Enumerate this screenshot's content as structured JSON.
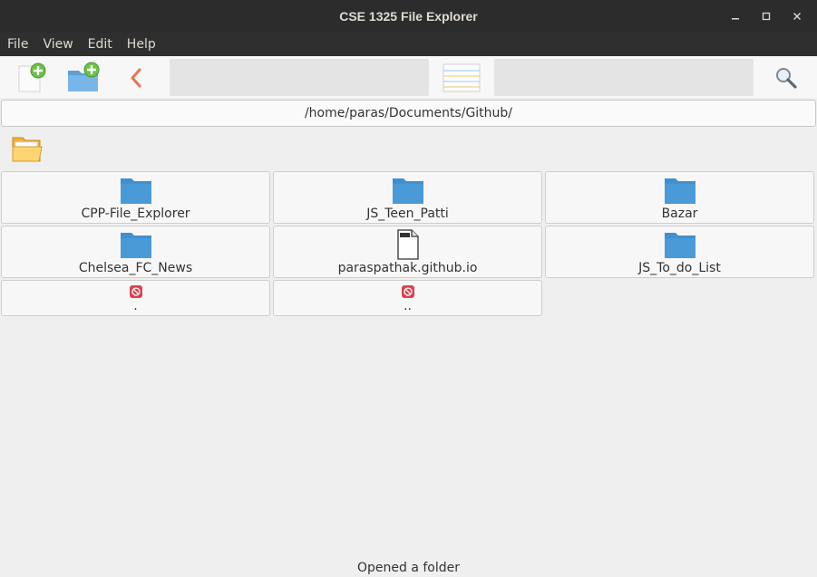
{
  "window": {
    "title": "CSE 1325 File Explorer",
    "controls": {
      "minimize": "–",
      "maximize": "☐",
      "close": "✕"
    }
  },
  "menubar": {
    "items": [
      "File",
      "View",
      "Edit",
      "Help"
    ]
  },
  "toolbar": {
    "new_file_icon": "new-file-icon",
    "new_folder_icon": "new-folder-icon",
    "back_icon": "back-icon",
    "view_icon": "view-list-icon",
    "search_icon": "search-icon"
  },
  "path": {
    "current": "/home/paras/Documents/Github/"
  },
  "entries": [
    {
      "name": "CPP-File_Explorer",
      "type": "folder"
    },
    {
      "name": "JS_Teen_Patti",
      "type": "folder"
    },
    {
      "name": "Bazar",
      "type": "folder"
    },
    {
      "name": "Chelsea_FC_News",
      "type": "folder"
    },
    {
      "name": "paraspathak.github.io",
      "type": "file"
    },
    {
      "name": "JS_To_do_List",
      "type": "folder"
    },
    {
      "name": ".",
      "type": "special"
    },
    {
      "name": "..",
      "type": "special"
    }
  ],
  "status": {
    "message": "Opened a folder"
  },
  "colors": {
    "titlebar": "#2c2c2c",
    "folder_blue": "#4a9ad8",
    "accent_orange": "#e9734a",
    "special_red": "#d9434f"
  }
}
